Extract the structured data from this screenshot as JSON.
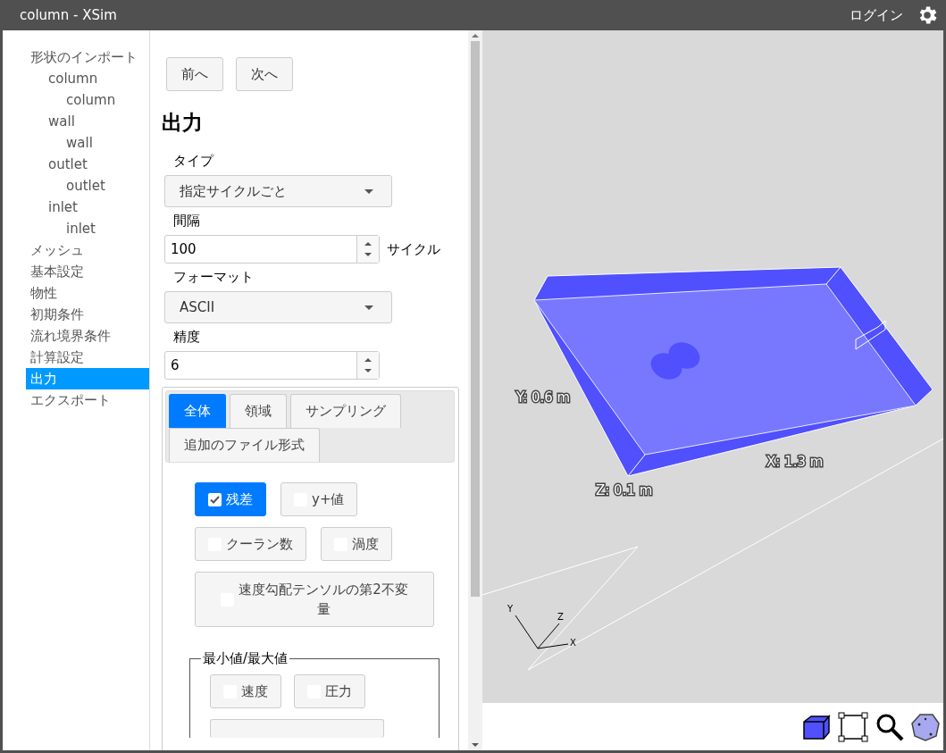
{
  "window": {
    "title": "column - XSim",
    "login": "ログイン"
  },
  "sidebar": {
    "items": [
      {
        "label": "形状のインポート",
        "selected": false,
        "children": [
          {
            "label": "column",
            "selected": false,
            "children": [
              {
                "label": "column",
                "selected": false
              }
            ]
          },
          {
            "label": "wall",
            "selected": false,
            "children": [
              {
                "label": "wall",
                "selected": false
              }
            ]
          },
          {
            "label": "outlet",
            "selected": false,
            "children": [
              {
                "label": "outlet",
                "selected": false
              }
            ]
          },
          {
            "label": "inlet",
            "selected": false,
            "children": [
              {
                "label": "inlet",
                "selected": false
              }
            ]
          }
        ]
      },
      {
        "label": "メッシュ",
        "selected": false
      },
      {
        "label": "基本設定",
        "selected": false
      },
      {
        "label": "物性",
        "selected": false
      },
      {
        "label": "初期条件",
        "selected": false
      },
      {
        "label": "流れ境界条件",
        "selected": false
      },
      {
        "label": "計算設定",
        "selected": false
      },
      {
        "label": "出力",
        "selected": true
      },
      {
        "label": "エクスポート",
        "selected": false
      }
    ]
  },
  "nav_buttons": [
    "前へ",
    "次へ"
  ],
  "heading": "出力",
  "fields": [
    {
      "kind": "select",
      "label": "タイプ",
      "value": "指定サイクルごと"
    },
    {
      "kind": "number",
      "label": "間隔",
      "value": "100",
      "unit": "サイクル"
    },
    {
      "kind": "select",
      "label": "フォーマット",
      "value": "ASCII"
    },
    {
      "kind": "number",
      "label": "精度",
      "value": "6"
    }
  ],
  "tabs": [
    {
      "label": "全体",
      "selected": true
    },
    {
      "label": "領域",
      "selected": false
    },
    {
      "label": "サンプリング",
      "selected": false
    },
    {
      "label": "追加のファイル形式",
      "selected": false
    }
  ],
  "options": [
    {
      "label": "残差",
      "checked": true
    },
    {
      "label": "y+値",
      "checked": false
    },
    {
      "label": "クーラン数",
      "checked": false
    },
    {
      "label": "渦度",
      "checked": false
    },
    {
      "label": "速度勾配テンソルの第2不変量",
      "checked": false
    }
  ],
  "min_max": {
    "legend": "最小値/最大値",
    "options": [
      {
        "label": "速度",
        "checked": false
      },
      {
        "label": "圧力",
        "checked": false
      }
    ]
  },
  "viewer": {
    "labels": [
      "Y: 0.6 m",
      "X: 1.3 m",
      "Z: 0.1 m"
    ],
    "triad": [
      "Y",
      "Z",
      "X"
    ]
  }
}
